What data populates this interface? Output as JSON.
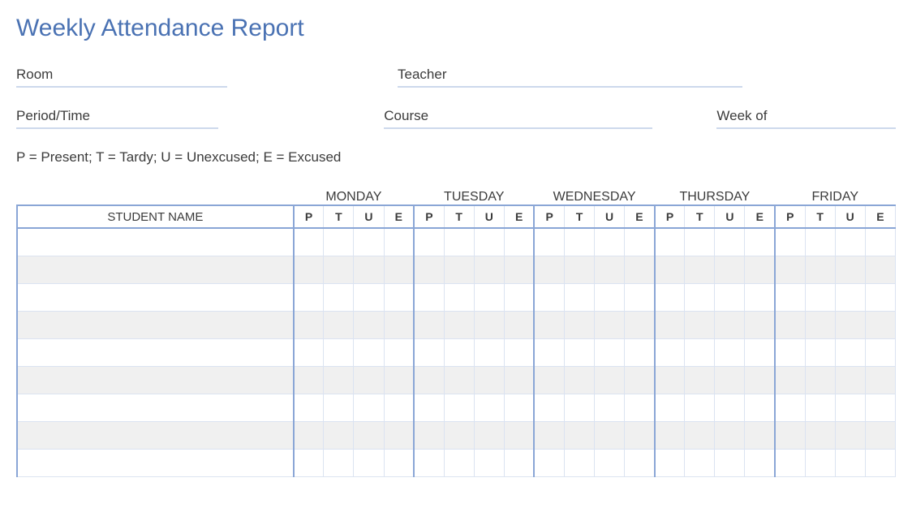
{
  "title": "Weekly Attendance Report",
  "fields": {
    "room": "Room",
    "teacher": "Teacher",
    "period": "Period/Time",
    "course": "Course",
    "week_of": "Week of"
  },
  "legend": "P = Present; T = Tardy; U = Unexcused; E = Excused",
  "student_name_header": "STUDENT NAME",
  "days": [
    "MONDAY",
    "TUESDAY",
    "WEDNESDAY",
    "THURSDAY",
    "FRIDAY"
  ],
  "codes": [
    "P",
    "T",
    "U",
    "E"
  ],
  "row_count": 9
}
